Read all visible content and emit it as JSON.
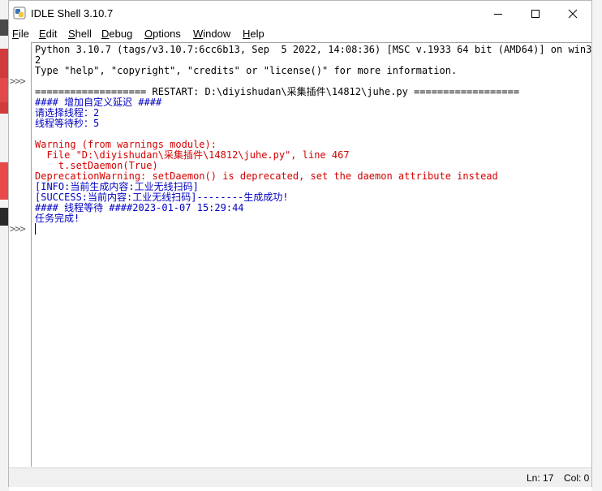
{
  "window": {
    "title": "IDLE Shell 3.10.7"
  },
  "menu": [
    {
      "label": "File",
      "accel": "F",
      "rest": "ile"
    },
    {
      "label": "Edit",
      "accel": "E",
      "rest": "dit"
    },
    {
      "label": "Shell",
      "accel": "S",
      "rest": "hell"
    },
    {
      "label": "Debug",
      "accel": "D",
      "rest": "ebug"
    },
    {
      "label": "Options",
      "accel": "O",
      "rest": "ptions"
    },
    {
      "label": "Window",
      "accel": "W",
      "rest": "indow"
    },
    {
      "label": "Help",
      "accel": "H",
      "rest": "elp"
    }
  ],
  "prompts": [
    ">>>",
    ">>>"
  ],
  "shell_lines": [
    {
      "text": "Python 3.10.7 (tags/v3.10.7:6cc6b13, Sep  5 2022, 14:08:36) [MSC v.1933 64 bit (AMD64)] on win3",
      "color": "black"
    },
    {
      "text": "2",
      "color": "black"
    },
    {
      "text": "Type \"help\", \"copyright\", \"credits\" or \"license()\" for more information.",
      "color": "black"
    },
    {
      "text": "",
      "color": "black"
    },
    {
      "text": "=================== RESTART: D:\\diyishudan\\采集插件\\14812\\juhe.py ==================",
      "color": "black"
    },
    {
      "text": "#### 增加自定义延迟 ####",
      "color": "blue"
    },
    {
      "text": "请选择线程：2",
      "color": "blue"
    },
    {
      "text": "线程等待秒：5",
      "color": "blue"
    },
    {
      "text": "",
      "color": "black"
    },
    {
      "text": "Warning (from warnings module):",
      "color": "red"
    },
    {
      "text": "  File \"D:\\diyishudan\\采集插件\\14812\\juhe.py\", line 467",
      "color": "red"
    },
    {
      "text": "    t.setDaemon(True)",
      "color": "red"
    },
    {
      "text": "DeprecationWarning: setDaemon() is deprecated, set the daemon attribute instead",
      "color": "red"
    },
    {
      "text": "[INFO:当前生成内容:工业无线扫码]",
      "color": "blue"
    },
    {
      "text": "[SUCCESS:当前内容:工业无线扫码]--------生成成功!",
      "color": "blue"
    },
    {
      "text": "#### 线程等待 ####2023-01-07 15:29:44",
      "color": "blue"
    },
    {
      "text": "任务完成!",
      "color": "blue"
    }
  ],
  "status": {
    "ln": "Ln: 17",
    "col": "Col: 0"
  }
}
